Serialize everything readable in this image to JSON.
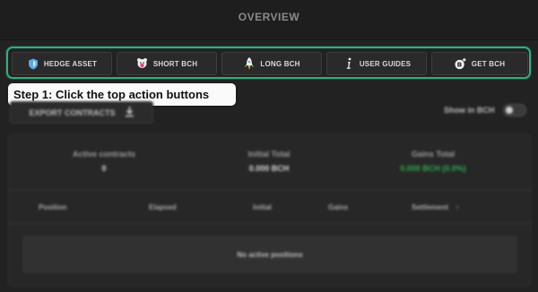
{
  "header": {
    "title": "OVERVIEW"
  },
  "actions": [
    {
      "label": "HEDGE ASSET",
      "icon": "shield-icon"
    },
    {
      "label": "SHORT BCH",
      "icon": "bear-icon"
    },
    {
      "label": "LONG BCH",
      "icon": "rocket-icon"
    },
    {
      "label": "USER GUIDES",
      "icon": "info-icon"
    },
    {
      "label": "GET BCH",
      "icon": "bitcoin-cash-icon"
    }
  ],
  "tooltip": {
    "text": "Step 1: Click the top action buttons"
  },
  "toolbar": {
    "export_label": "EXPORT CONTRACTS",
    "show_in_bch_label": "Show in BCH"
  },
  "stats": {
    "active_contracts": {
      "label": "Active contracts",
      "value": "0"
    },
    "initial_total": {
      "label": "Initial Total",
      "value": "0.000 BCH"
    },
    "gains_total": {
      "label": "Gains Total",
      "value": "0.000 BCH (0.0%)"
    }
  },
  "table": {
    "columns": [
      "Position",
      "Elapsed",
      "Initial",
      "Gains",
      "Settlement"
    ],
    "sort_indicator": "↑",
    "empty_text": "No active positions"
  },
  "colors": {
    "accent": "#2fae7d",
    "gains": "#2fa84f"
  }
}
